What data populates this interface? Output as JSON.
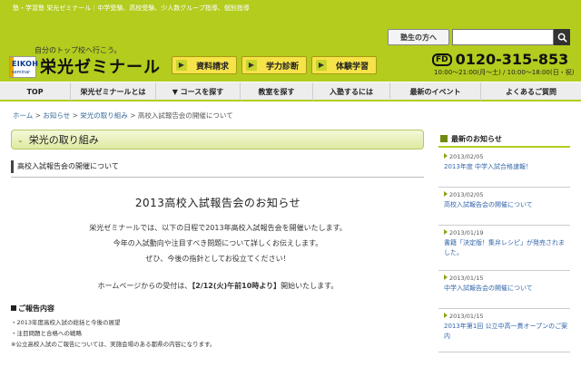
{
  "header": {
    "tagline": "塾・学習塾 栄光ゼミナール｜中学受験、高校受験、少人数グループ指導、個別指導",
    "slogan": "自分のトップ校へ行こう。",
    "logo_text": "EIKOH",
    "logo_sub": "seminar",
    "brand": "栄光ゼミナール",
    "buttons": [
      "資料請求",
      "学力診断",
      "体験学習"
    ],
    "student_button": "塾生の方へ",
    "search_placeholder": "",
    "phone_prefix": "FD",
    "phone": "0120-315-853",
    "hours": "10:00～21:00(月～土) / 10:00～18:00(日・祝)",
    "accent_color": "#b3cc1e"
  },
  "nav": {
    "items": [
      "TOP",
      "栄光ゼミナールとは",
      "▼ コースを探す",
      "教室を探す",
      "入塾するには",
      "最新のイベント",
      "よくあるご質問"
    ]
  },
  "breadcrumb": {
    "items": [
      "ホーム",
      "お知らせ",
      "栄光の取り組み",
      "高校入試報告会の開催について"
    ],
    "separator": ">"
  },
  "main": {
    "section_title": "栄光の取り組み",
    "article_title": "高校入試報告会の開催について",
    "body_title": "2013高校入試報告会のお知らせ",
    "paragraphs": [
      "栄光ゼミナールでは、以下の日程で2013年高校入試報告会を開催いたします。",
      "今年の入試動向や注目すべき問題について詳しくお伝えします。",
      "ぜひ、今後の指針としてお役立てください！"
    ],
    "reception_prefix": "ホームページからの受付は、",
    "reception_date": "【2/12(火)午前10時より】",
    "reception_suffix": "開始いたします。",
    "report_heading": "ご報告内容",
    "report_items": [
      "・2013年度高校入試の総括と今後の展望",
      "・注目問題と合格への戦略",
      "※公立高校入試のご報告については、実施会場のある都県の内容になります。"
    ]
  },
  "sidebar": {
    "heading": "最新のお知らせ",
    "news": [
      {
        "date": "2013/02/05",
        "title": "2013年度 中学入試合格速報！"
      },
      {
        "date": "2013/02/05",
        "title": "高校入試報告会の開催について"
      },
      {
        "date": "2013/01/19",
        "title": "書籍「決定版！集弁レシピ」が発売されました。"
      },
      {
        "date": "2013/01/15",
        "title": "中学入試報告会の開催について"
      },
      {
        "date": "2013/01/15",
        "title": "2013年第1回 公立中高一貫オープンのご案内"
      }
    ]
  }
}
